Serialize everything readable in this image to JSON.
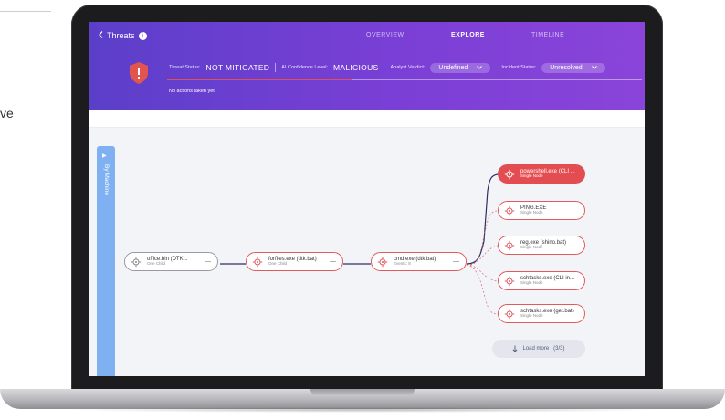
{
  "page_fragment": "ve",
  "app": {
    "back_label": "Threats",
    "info_icon": "i",
    "tabs": [
      {
        "label": "OVERVIEW",
        "active": false
      },
      {
        "label": "EXPLORE",
        "active": true
      },
      {
        "label": "TIMELINE",
        "active": false
      }
    ]
  },
  "threat": {
    "status_label": "Threat Status:",
    "status_value": "NOT MITIGATED",
    "confidence_label": "AI Confidence Level:",
    "confidence_value": "MALICIOUS",
    "verdict_label": "Analyst Verdict:",
    "verdict_value": "Undefined",
    "incident_label": "Incident Status:",
    "incident_value": "Unresolved",
    "actions_text": "No actions taken yet",
    "shield_glyph": "!"
  },
  "sidebar": {
    "machine_label": "By Machine"
  },
  "graph": {
    "nodes": [
      {
        "title": "office.bin (DTK...",
        "subtitle": "One Child",
        "style": "gray"
      },
      {
        "title": "forfiles.exe (dtk.bat)",
        "subtitle": "One Child",
        "style": "red"
      },
      {
        "title": "cmd.exe (dtk.bat)",
        "subtitle": "Events: 8",
        "style": "red"
      },
      {
        "title": "powershell.exe (CLI ...",
        "subtitle": "Single Node",
        "style": "solid"
      },
      {
        "title": "PING.EXE",
        "subtitle": "Single Node",
        "style": "red"
      },
      {
        "title": "reg.exe (shino.bat)",
        "subtitle": "Single Node",
        "style": "red"
      },
      {
        "title": "schtasks.exe (CLI in...",
        "subtitle": "Single Node",
        "style": "red"
      },
      {
        "title": "schtasks.exe (get.bat)",
        "subtitle": "Single Node",
        "style": "red"
      }
    ],
    "expand_glyph": "—",
    "load_more_label": "Load more",
    "load_more_count": "(3/3)"
  },
  "colors": {
    "header_start": "#5b3fc9",
    "header_end": "#8a44d9",
    "threat_red": "#e34d51",
    "edge_navy": "#2d2f66",
    "machine_tab_blue": "#7fb0f2"
  },
  "icons": {
    "back": "chevron-left-icon",
    "info": "info-icon",
    "shield": "shield-alert-icon",
    "dropdown": "chevron-down-icon",
    "process": "gear-icon",
    "load_more": "arrow-down-icon",
    "expand": "chevron-right-icon"
  }
}
